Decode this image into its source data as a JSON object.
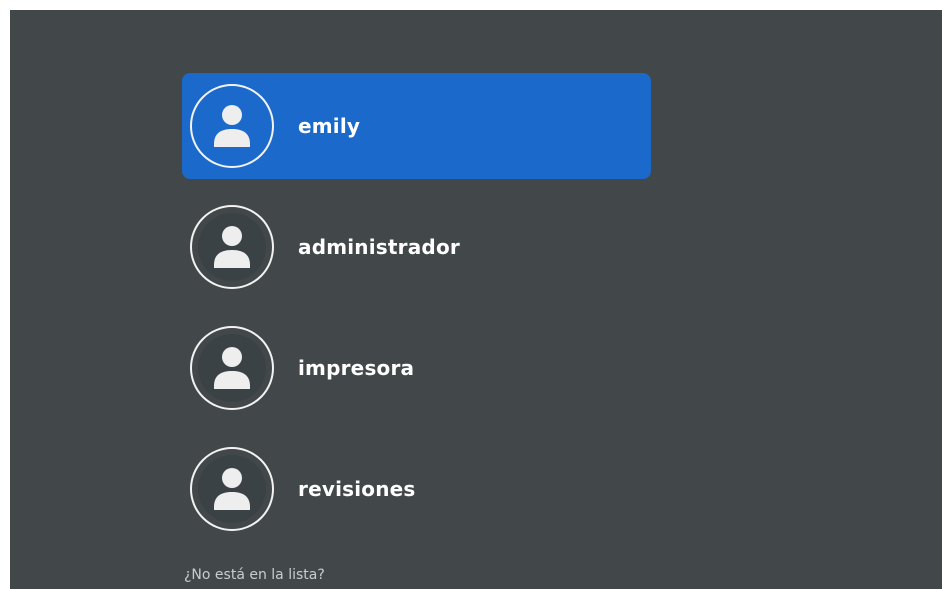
{
  "login": {
    "users": [
      {
        "name": "emily",
        "selected": true,
        "icon": "user-avatar-icon"
      },
      {
        "name": "administrador",
        "selected": false,
        "icon": "user-avatar-icon"
      },
      {
        "name": "impresora",
        "selected": false,
        "icon": "user-avatar-icon"
      },
      {
        "name": "revisiones",
        "selected": false,
        "icon": "user-avatar-icon"
      }
    ],
    "not_listed_label": "¿No está en la lista?"
  },
  "colors": {
    "background": "#42474a",
    "selected": "#1b6acb",
    "text": "#ffffff",
    "muted_text": "#c8ccd0"
  }
}
